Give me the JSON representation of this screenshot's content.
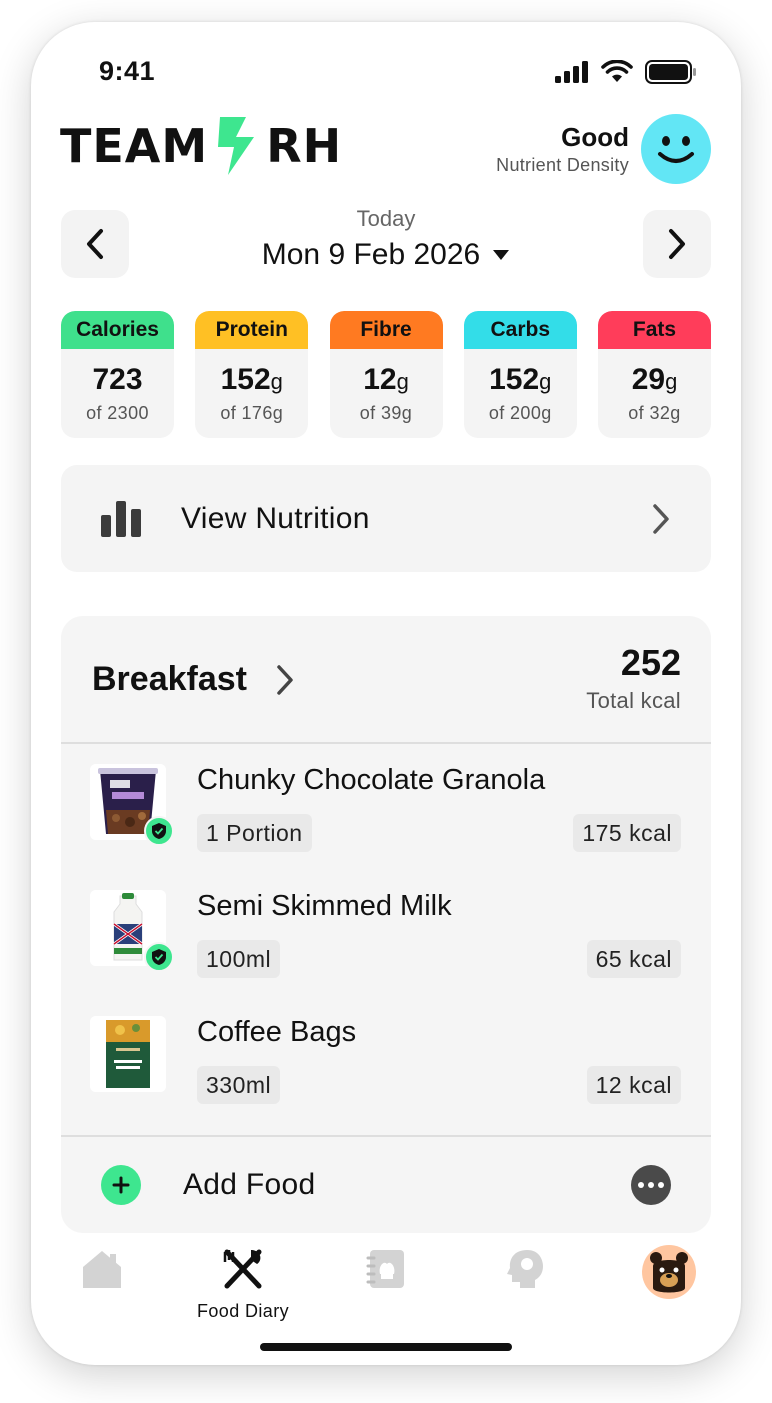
{
  "status_bar": {
    "time": "9:41"
  },
  "header": {
    "logo_left": "TEAM",
    "logo_right": "RH",
    "nutrient_density_value": "Good",
    "nutrient_density_label": "Nutrient Density",
    "face_color": "#62e6f5"
  },
  "date_nav": {
    "subtitle": "Today",
    "date": "Mon 9 Feb 2026"
  },
  "macros": [
    {
      "name": "Calories",
      "value": "723",
      "unit": "",
      "target": "of 2300",
      "color": "#3fe08c"
    },
    {
      "name": "Protein",
      "value": "152",
      "unit": "g",
      "target": "of 176g",
      "color": "#ffc024"
    },
    {
      "name": "Fibre",
      "value": "12",
      "unit": "g",
      "target": "of 39g",
      "color": "#ff7a21"
    },
    {
      "name": "Carbs",
      "value": "152",
      "unit": "g",
      "target": "of 200g",
      "color": "#33dde8"
    },
    {
      "name": "Fats",
      "value": "29",
      "unit": "g",
      "target": "of 32g",
      "color": "#ff3d5a"
    }
  ],
  "view_nutrition": {
    "label": "View Nutrition"
  },
  "meal": {
    "title": "Breakfast",
    "total_kcal": "252",
    "total_label": "Total kcal",
    "items": [
      {
        "name": "Chunky Chocolate Granola",
        "portion": "1 Portion",
        "kcal": "175 kcal",
        "verified": true
      },
      {
        "name": "Semi Skimmed Milk",
        "portion": "100ml",
        "kcal": "65 kcal",
        "verified": true
      },
      {
        "name": "Coffee Bags",
        "portion": "330ml",
        "kcal": "12 kcal",
        "verified": false
      }
    ],
    "add_label": "Add Food"
  },
  "tabbar": {
    "active_label": "Food Diary"
  },
  "colors": {
    "accent_green": "#3ee68f"
  }
}
